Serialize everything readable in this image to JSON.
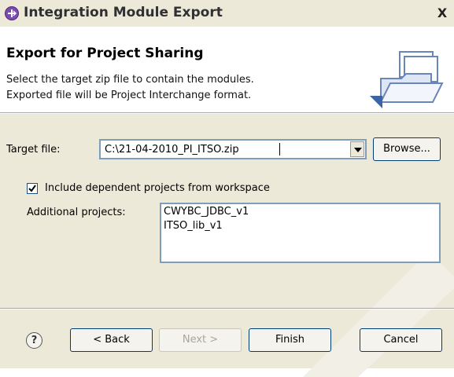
{
  "window": {
    "title": "Integration Module Export",
    "close_glyph": "X",
    "icon": "integration-module-icon"
  },
  "header": {
    "title": "Export for Project Sharing",
    "description_line1": "Select the target zip file to contain the modules.",
    "description_line2": "Exported file will be Project Interchange format.",
    "icon": "folder-open-icon"
  },
  "form": {
    "target_file_label": "Target file:",
    "target_file_value": "C:\\21-04-2010_PI_ITSO.zip",
    "browse_label": "Browse...",
    "include_dependent_label": "Include dependent projects from workspace",
    "include_dependent_checked": true,
    "additional_projects_label": "Additional projects:",
    "additional_projects": [
      "CWYBC_JDBC_v1",
      "ITSO_lib_v1"
    ]
  },
  "footer": {
    "help_glyph": "?",
    "back_label": "< Back",
    "next_label": "Next >",
    "finish_label": "Finish",
    "cancel_label": "Cancel",
    "next_enabled": false
  },
  "colors": {
    "title_icon": "#7d4bb0",
    "dialog_bg": "#ece9d8",
    "field_border": "#7f9db9"
  }
}
